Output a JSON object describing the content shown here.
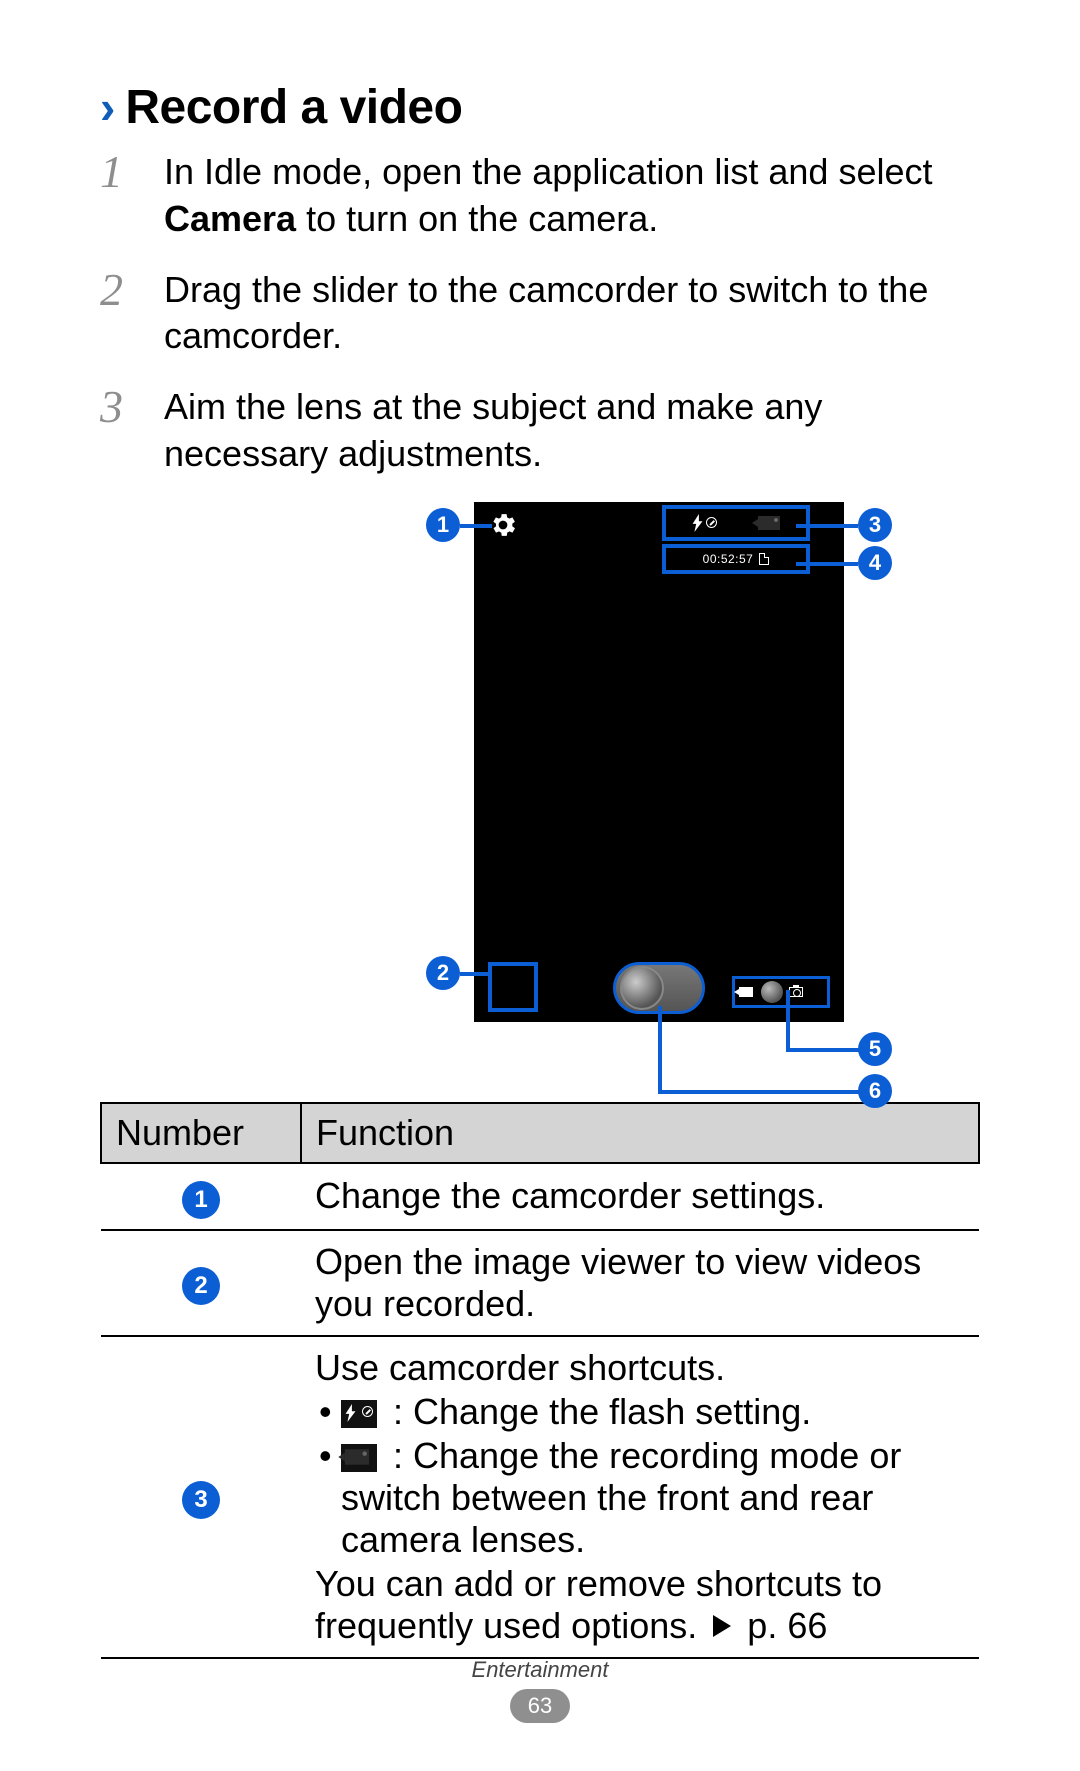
{
  "heading": "Record a video",
  "steps": [
    {
      "n": "1",
      "pre": "In Idle mode, open the application list and select ",
      "bold": "Camera",
      "post": " to turn on the camera."
    },
    {
      "n": "2",
      "text": "Drag the slider to the camcorder to switch to the camcorder."
    },
    {
      "n": "3",
      "text": "Aim the lens at the subject and make any necessary adjustments."
    }
  ],
  "screenshot": {
    "timestamp": "00:52:57",
    "callouts": {
      "1": "1",
      "2": "2",
      "3": "3",
      "4": "4",
      "5": "5",
      "6": "6"
    }
  },
  "table": {
    "headers": {
      "number": "Number",
      "function": "Function"
    },
    "rows": {
      "r1": "Change the camcorder settings.",
      "r2": "Open the image viewer to view videos you recorded.",
      "r3": {
        "intro": "Use camcorder shortcuts.",
        "b1": ": Change the flash setting.",
        "b2": ": Change the recording mode or switch between the front and rear camera lenses.",
        "outro_pre": "You can add or remove shortcuts to frequently used options.",
        "page_ref": "p. 66"
      }
    }
  },
  "footer": {
    "section": "Entertainment",
    "page": "63"
  }
}
